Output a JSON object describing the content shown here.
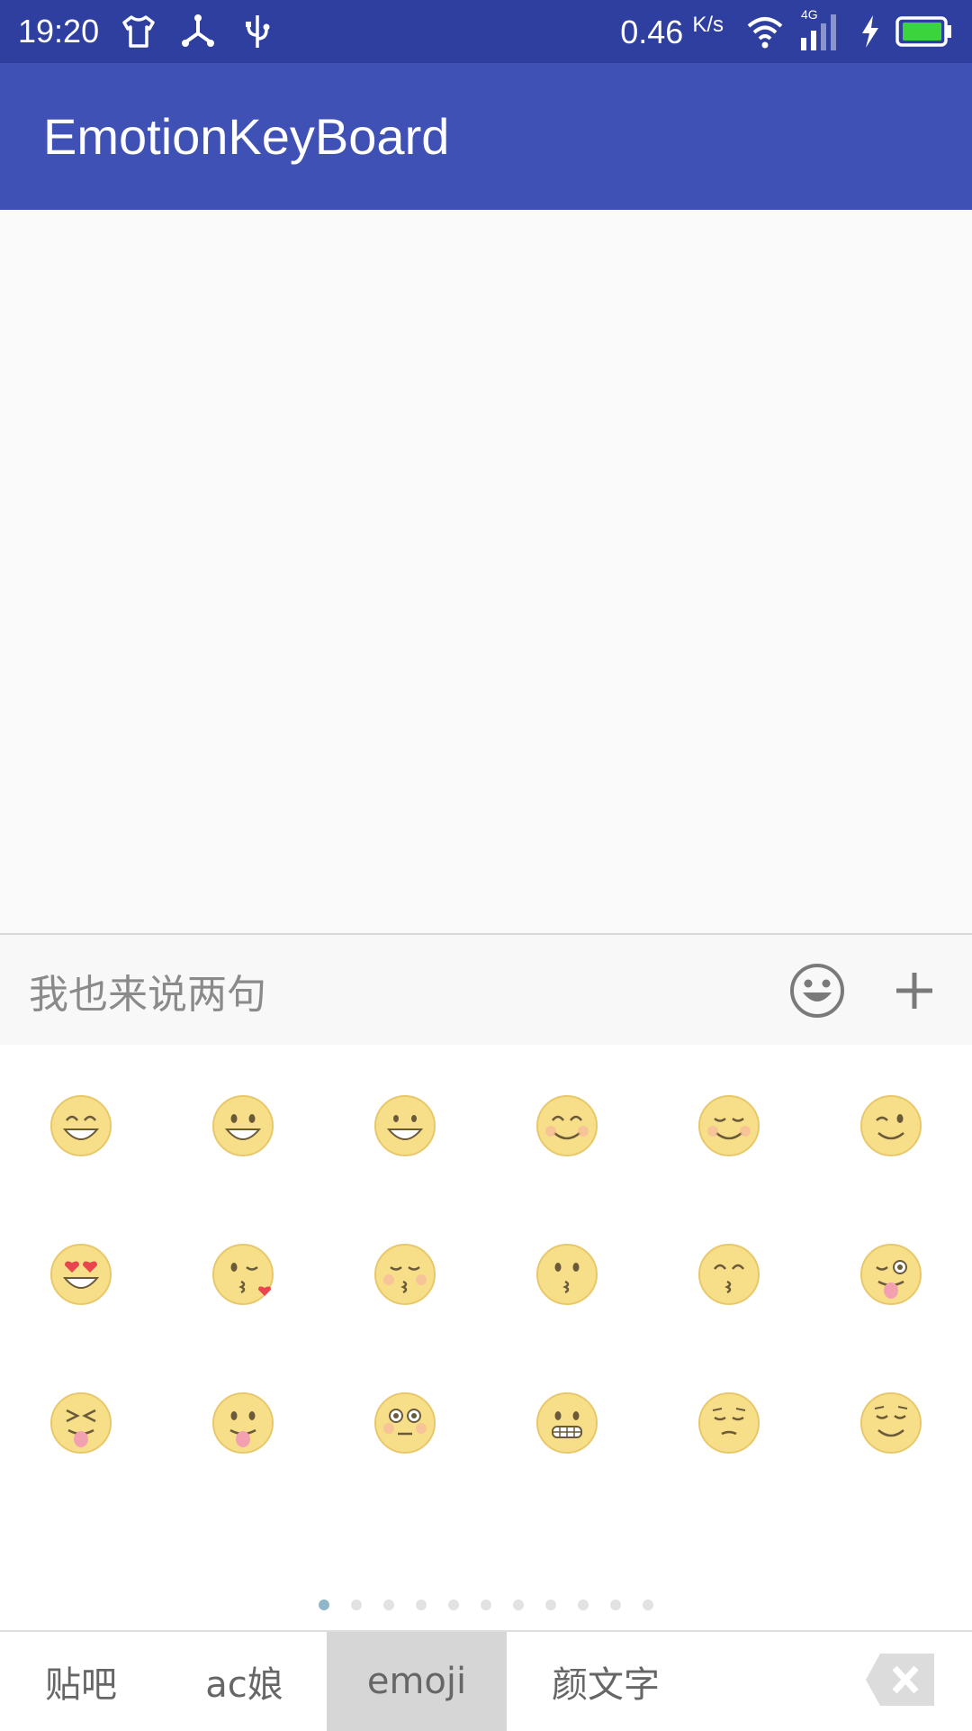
{
  "status_bar": {
    "time": "19:20",
    "speed": "0.46",
    "speed_unit": "K/s",
    "network": "4G",
    "icons": [
      "shirt-icon",
      "share-icon",
      "usb-icon",
      "wifi-icon",
      "signal-icon",
      "charging-icon",
      "battery-icon"
    ]
  },
  "app_bar": {
    "title": "EmotionKeyBoard"
  },
  "input_bar": {
    "placeholder": "我也来说两句",
    "icons": [
      "emoji-face-icon",
      "plus-icon"
    ]
  },
  "emoji_grid": {
    "rows": [
      [
        "grin",
        "smiley",
        "grinning",
        "blush",
        "relaxed",
        "wink"
      ],
      [
        "heart-eyes",
        "kissing-heart",
        "kissing-closed-eyes",
        "kissing",
        "kissing-smiling-eyes",
        "stuck-out-tongue-winking-eye"
      ],
      [
        "stuck-out-tongue-closed-eyes",
        "stuck-out-tongue",
        "flushed",
        "grimacing",
        "pensive",
        "relieved"
      ]
    ],
    "page_count": 11,
    "active_page": 1
  },
  "tabs": [
    {
      "label": "贴吧",
      "selected": false
    },
    {
      "label": "ac娘",
      "selected": false
    },
    {
      "label": "emoji",
      "selected": true
    },
    {
      "label": "颜文字",
      "selected": false
    }
  ],
  "colors": {
    "status_bar": "#2f3fa0",
    "app_bar": "#3f51b5",
    "selected_tab": "#d6d6d6",
    "active_dot": "#8fb7c7"
  }
}
